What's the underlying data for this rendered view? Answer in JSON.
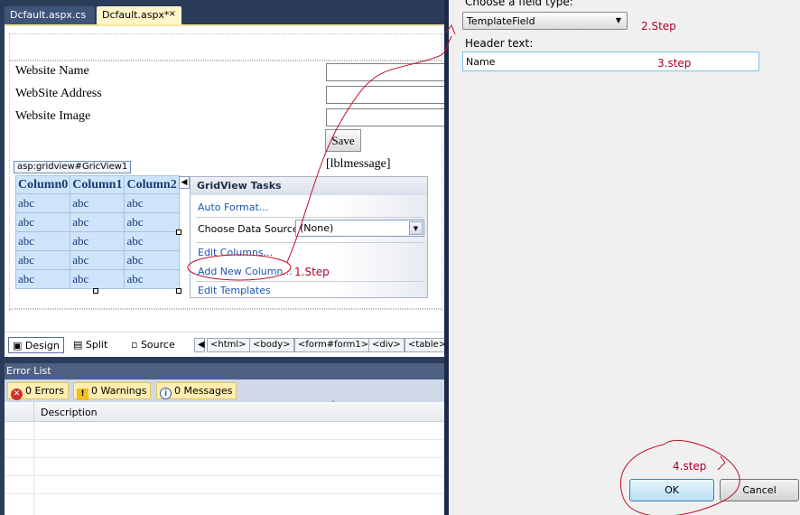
{
  "tabs": [
    {
      "label": "Dcfault.aspx.cs",
      "active": false
    },
    {
      "label": "Dcfault.aspx*",
      "active": true,
      "close": "×"
    }
  ],
  "form": {
    "labels": [
      "Website Name",
      "WebSite Address",
      "Website Image"
    ],
    "save_label": "Save",
    "message_label": "[lblmessage]"
  },
  "gridview": {
    "tag": "asp:gridview#GricView1",
    "columns": [
      "Column0",
      "Column1",
      "Column2"
    ],
    "rows": [
      [
        "abc",
        "abc",
        "abc"
      ],
      [
        "abc",
        "abc",
        "abc"
      ],
      [
        "abc",
        "abc",
        "abc"
      ],
      [
        "abc",
        "abc",
        "abc"
      ],
      [
        "abc",
        "abc",
        "abc"
      ]
    ]
  },
  "tasks": {
    "title": "GridView Tasks",
    "auto_format": "Auto Format...",
    "data_source_label": "Choose Data Source",
    "data_source_value": "(None)",
    "edit_columns": "Edit Columns...",
    "add_new_column": "Add New Column...",
    "edit_templates": "Edit Templates"
  },
  "view_bar": {
    "design": "Design",
    "split": "Split",
    "source": "Source",
    "breadcrumbs": [
      "<html>",
      "<body>",
      "<form#form1>",
      "<div>",
      "<table>"
    ]
  },
  "error_list": {
    "title": "Error List",
    "errors": "0 Errors",
    "warnings": "0 Warnings",
    "messages": "0 Messages",
    "column": "Description"
  },
  "dialog": {
    "field_type_label": "Choose a field type:",
    "field_type_value": "TemplateField",
    "header_text_label": "Header text:",
    "header_text_value": "Name",
    "ok_label": "OK",
    "cancel_label": "Cancel"
  },
  "annotations": {
    "step1": "1.Step",
    "step2": "2.Step",
    "step3": "3.step",
    "step4": "4.step"
  },
  "colors": {
    "ide_background": "#2b3c59",
    "active_tab": "#fff6c9",
    "grid_fill": "#cde4fb",
    "annotation": "#b0002a"
  }
}
